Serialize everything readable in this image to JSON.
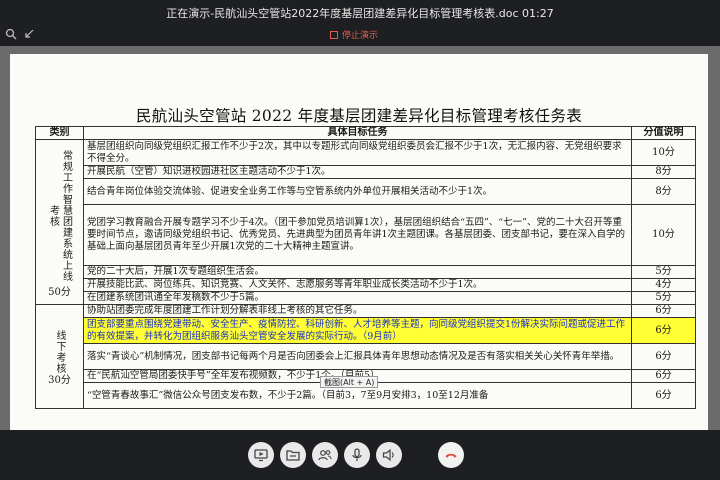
{
  "window": {
    "title": "正在演示-民航汕头空管站2022年度基层团建差异化目标管理考核表.doc 01:27"
  },
  "toolbar": {
    "stop_label": "停止演示"
  },
  "document": {
    "title": "民航汕头空管站 2022 年度基层团建差异化目标管理考核任务表",
    "headers": [
      "类别",
      "具体目标任务",
      "分值说明"
    ],
    "category1": {
      "col_a": "常规工作智慧团建系统上线考核",
      "col_b": "",
      "score": "50分"
    },
    "category2": {
      "label": "线下考核",
      "score": "30分"
    },
    "rows1": [
      {
        "task": "基层团组织向同级党组织汇报工作不少于2次，其中以专题形式向同级党组织委员会汇报不少于1次，无汇报内容、无党组织要求不得全分。",
        "score": "10分"
      },
      {
        "task": "开展民航（空管）知识进校园进社区主题活动不少于1次。",
        "score": "8分"
      },
      {
        "task": "结合青年岗位体验交流体验、促进安全业务工作等与空管系统内外单位开展相关活动不少于1次。",
        "score": "8分"
      },
      {
        "task": "党团学习教育融合开展专题学习不少于4次。（团干参加党员培训算1次），基层团组织结合“五四”、“七一”、党的二十大召开等重要时间节点，邀请同级党组织书记、优秀党员、先进典型为团员青年讲1次主题团课。各基层团委、团支部书记，要在深入自学的基础上面向基层团员青年至少开展1次党的二十大精神主题宣讲。",
        "score": "10分"
      },
      {
        "task": "党的二十大后，开展1次专题组织生活会。",
        "score": "5分"
      },
      {
        "task": "开展技能比武、岗位练兵、知识竞赛、人文关怀、志愿服务等青年职业成长类活动不少于1次。",
        "score": "4分"
      },
      {
        "task": "在团建系统团讯通全年发稿数不少于5篇。",
        "score": "5分"
      }
    ],
    "rows2": [
      {
        "task": "协助站团委完成年度团建工作计划分解表非线上考核的其它任务。",
        "score": "6分",
        "highlight": false
      },
      {
        "task": "团支部要重点围绕党建带动、安全生产、疫情防控、科研创新、人才培养等主题，向同级党组织提交1份解决实际问题或促进工作的有效提案，并转化为团组织服务汕头空管安全发展的实际行动。（9月前）",
        "score": "6分",
        "highlight": true
      },
      {
        "task": "落实“青谈心”机制情况，团支部书记每两个月是否向团委会上汇报具体青年思想动态情况及是否有落实相关关心关怀青年举措。",
        "score": "6分",
        "highlight": false
      },
      {
        "task": "在“民航汕空管局团委快手号”全年发布视频数，不少于1个。（目前5）",
        "score": "6分",
        "highlight": false
      },
      {
        "task": "“空管青春故事汇”微信公众号团支发布数，不少于2篇。（目前3，7至9月安排3，10至12月准备",
        "score": "6分",
        "highlight": false
      }
    ]
  },
  "tooltip": {
    "text": "截图(Alt + A)"
  },
  "controls": {
    "buttons": [
      "share-screen",
      "folder",
      "participants",
      "microphone",
      "speaker",
      "hang-up"
    ]
  },
  "colors": {
    "highlight": "#ffff33",
    "highlight_text": "#1a30c8",
    "stop": "#e25c4b",
    "hangup": "#e04a3c"
  }
}
